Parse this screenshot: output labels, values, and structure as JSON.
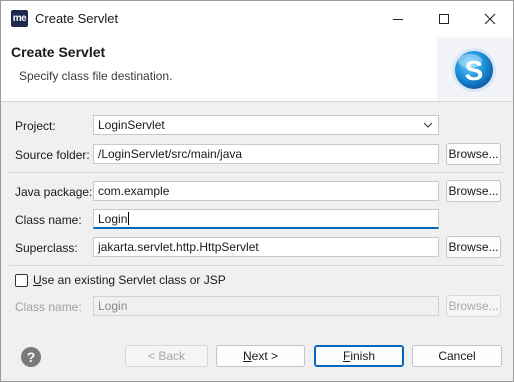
{
  "window": {
    "app_icon_text": "me",
    "title": "Create Servlet"
  },
  "banner": {
    "title": "Create Servlet",
    "message": "Specify class file destination.",
    "logo_icon": "servlet-s-logo",
    "logo_letter": "S"
  },
  "form": {
    "project": {
      "label": "Project:",
      "value": "LoginServlet"
    },
    "source_folder": {
      "label": "Source folder:",
      "value": "/LoginServlet/src/main/java",
      "button": "Browse..."
    },
    "java_package": {
      "label": "Java package:",
      "value": "com.example",
      "button": "Browse..."
    },
    "class_name": {
      "label": "Class name:",
      "value": "Login"
    },
    "superclass": {
      "label": "Superclass:",
      "value": "jakarta.servlet.http.HttpServlet",
      "button": "Browse..."
    },
    "existing": {
      "checkbox_prefix": "U",
      "checkbox_rest": "se an existing Servlet class or JSP",
      "checked": false,
      "class_label": "Class name:",
      "class_value": "Login",
      "button": "Browse..."
    }
  },
  "footer": {
    "help_icon": "help-icon",
    "back": "< Back",
    "next_prefix": "N",
    "next_rest": "ext >",
    "finish_prefix": "F",
    "finish_rest": "inish",
    "cancel": "Cancel"
  },
  "colors": {
    "accent": "#0067c0",
    "logo_blue": "#1b8fd8"
  }
}
